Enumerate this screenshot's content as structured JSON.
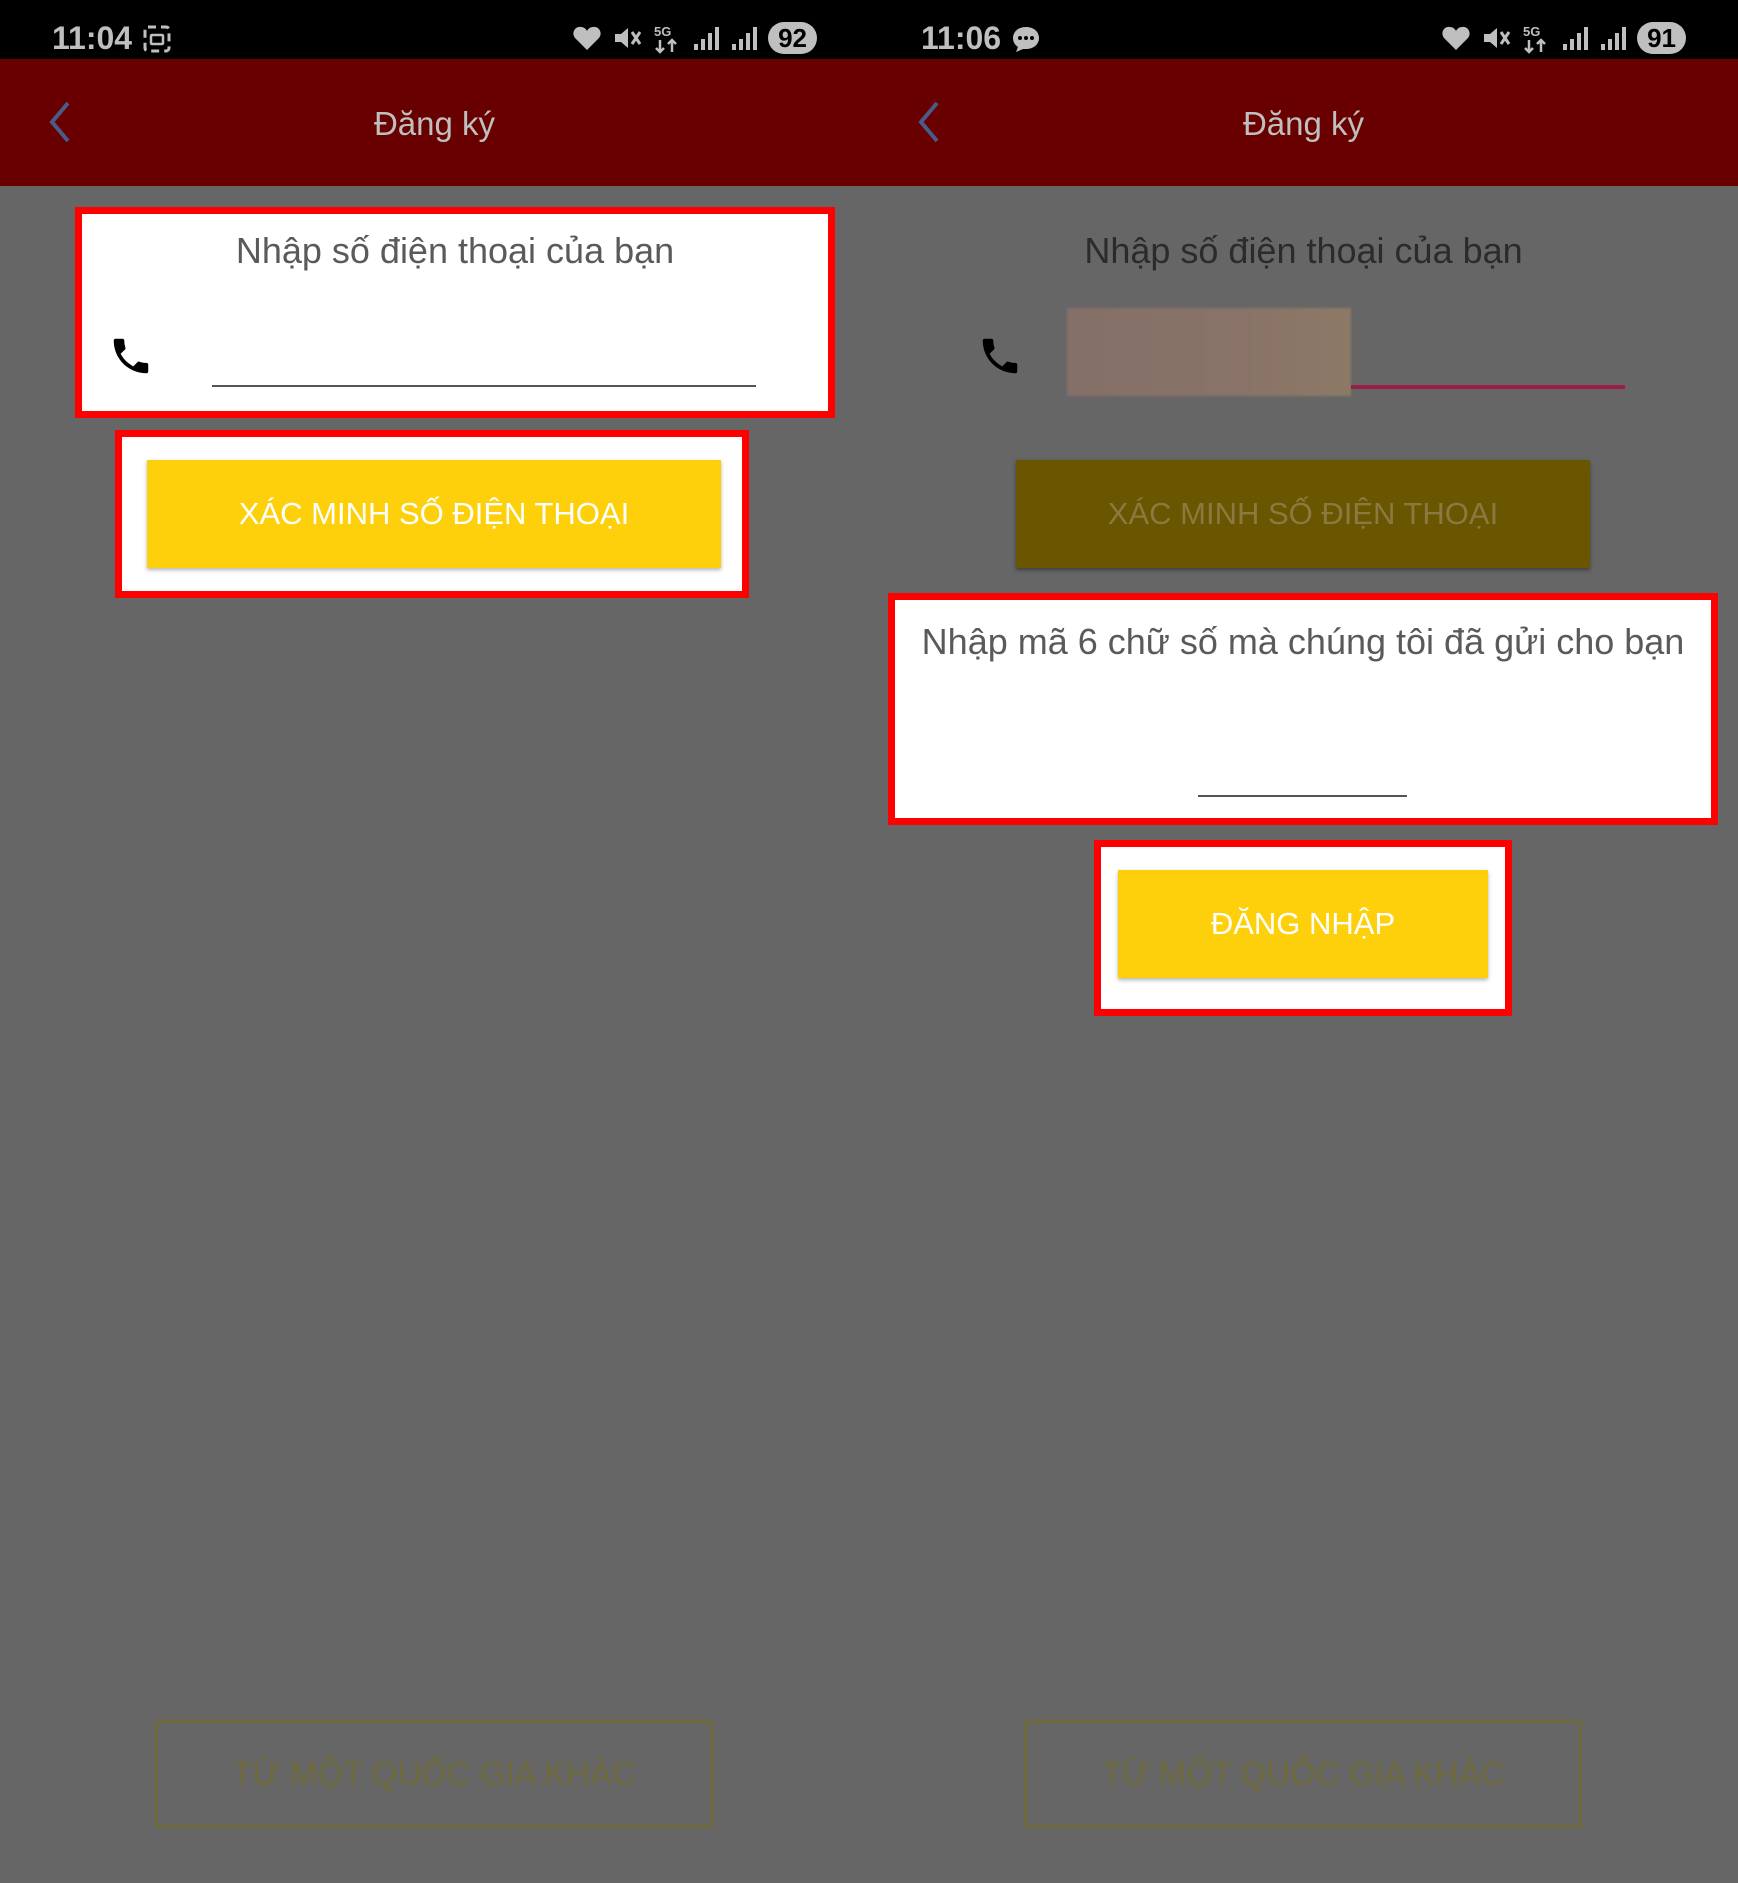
{
  "left_screen": {
    "status_bar": {
      "time": "11:04",
      "left_icon": "screenshot-icon",
      "battery": "92"
    },
    "app_bar": {
      "title": "Đăng ký",
      "back_icon": "chevron-left-icon"
    },
    "phone_prompt": "Nhập số điện thoại của bạn",
    "phone_input": {
      "value": "",
      "placeholder": ""
    },
    "verify_button": "XÁC MINH SỐ ĐIỆN THOẠI",
    "other_country_button": "TỪ MỘT QUỐC GIA KHÁC"
  },
  "right_screen": {
    "status_bar": {
      "time": "11:06",
      "left_icon": "message-icon",
      "battery": "91"
    },
    "app_bar": {
      "title": "Đăng ký",
      "back_icon": "chevron-left-icon"
    },
    "phone_prompt": "Nhập số điện thoại của bạn",
    "phone_input": {
      "value": "",
      "placeholder": ""
    },
    "verify_button": "XÁC MINH SỐ ĐIỆN THOẠI",
    "code_prompt": "Nhập mã 6 chữ số mà chúng tôi đã gửi cho bạn",
    "code_input": {
      "value": "",
      "placeholder": ""
    },
    "login_button": "ĐĂNG NHẬP",
    "other_country_button": "TỪ MỘT QUỐC GIA KHÁC"
  },
  "colors": {
    "app_bar": "#690000",
    "overlay_background": "#666666",
    "button_yellow": "#fdd00b",
    "highlight_red": "#ff0000"
  }
}
